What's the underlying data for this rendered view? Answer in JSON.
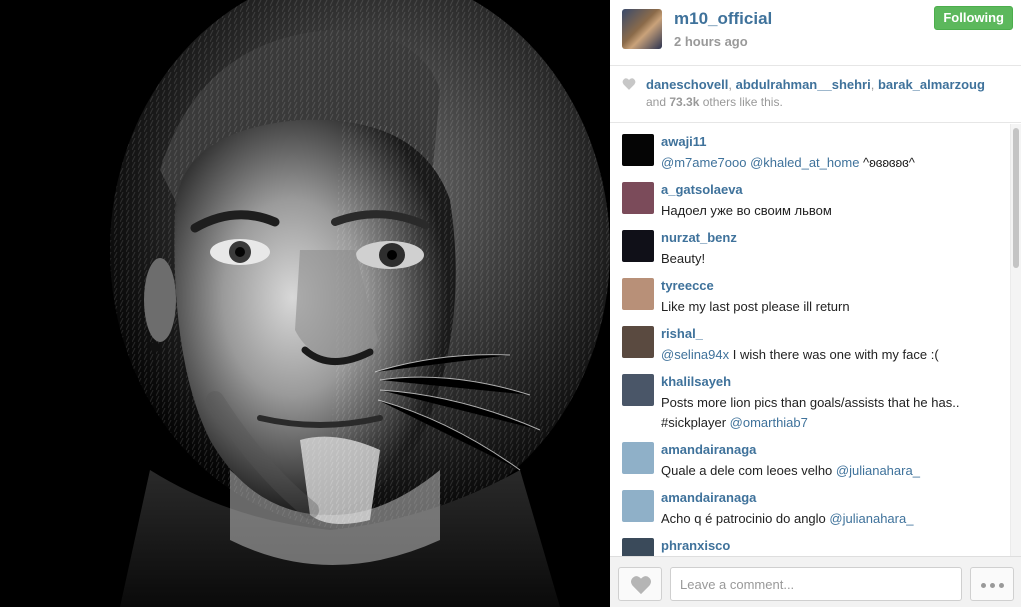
{
  "post": {
    "username": "m10_official",
    "time": "2 hours ago",
    "follow_label": "Following"
  },
  "likes": {
    "users": [
      "daneschovell",
      "abdulrahman__shehri",
      "barak_almarzoug"
    ],
    "separator": ",",
    "and_text": "and",
    "count": "73.3k",
    "suffix": "others like this."
  },
  "comments": [
    {
      "user": "awaji11",
      "parts": [
        {
          "t": "@m7ame7ooo",
          "m": true
        },
        {
          "t": " ",
          "m": false
        },
        {
          "t": "@khaled_at_home",
          "m": true
        },
        {
          "t": " ^ʚɞʚɞʚɞ^",
          "m": false
        }
      ],
      "avatar": "#050505"
    },
    {
      "user": "a_gatsolaeva",
      "parts": [
        {
          "t": "Надоел уже во своим львом",
          "m": false
        }
      ],
      "avatar": "#7b4b5a"
    },
    {
      "user": "nurzat_benz",
      "parts": [
        {
          "t": "Beauty!",
          "m": false
        }
      ],
      "avatar": "#101018"
    },
    {
      "user": "tyreecce",
      "parts": [
        {
          "t": "Like my last post please ill return",
          "m": false
        }
      ],
      "avatar": "#b89078"
    },
    {
      "user": "rishal_",
      "parts": [
        {
          "t": "@selina94x",
          "m": true
        },
        {
          "t": " I wish there was one with my face :(",
          "m": false
        }
      ],
      "avatar": "#5a4a40"
    },
    {
      "user": "khalilsayeh",
      "parts": [
        {
          "t": "Posts more lion pics than goals/assists that he has.. #sickplayer ",
          "m": false
        },
        {
          "t": "@omarthiab7",
          "m": true
        }
      ],
      "avatar": "#4a5668"
    },
    {
      "user": "amandairanaga",
      "parts": [
        {
          "t": "Quale a dele com leoes velho ",
          "m": false
        },
        {
          "t": "@julianahara_",
          "m": true
        }
      ],
      "avatar": "#8fb0c8"
    },
    {
      "user": "amandairanaga",
      "parts": [
        {
          "t": "Acho q é patrocinio do anglo ",
          "m": false
        },
        {
          "t": "@julianahara_",
          "m": true
        }
      ],
      "avatar": "#8fb0c8"
    },
    {
      "user": "phranxisco",
      "parts": [],
      "avatar": "#3a4a5a"
    }
  ],
  "comment_box": {
    "placeholder": "Leave a comment..."
  },
  "icons": {
    "like": "heart-icon",
    "more": "ellipsis-icon"
  },
  "colors": {
    "link": "#3f729b",
    "follow_button": "#5cb85c",
    "muted": "#999999"
  }
}
